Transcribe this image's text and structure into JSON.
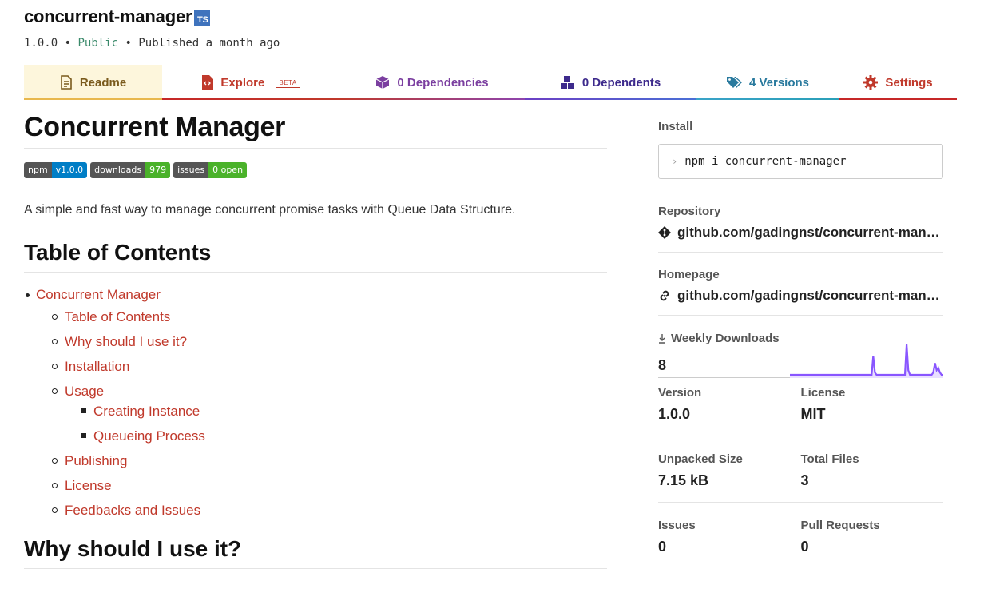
{
  "header": {
    "package_name": "concurrent-manager",
    "ts_badge": "TS",
    "version": "1.0.0",
    "separator": "•",
    "visibility": "Public",
    "published": "Published a month ago"
  },
  "tabs": [
    {
      "label": "Readme"
    },
    {
      "label": "Explore",
      "badge": "BETA"
    },
    {
      "label": "0 Dependencies"
    },
    {
      "label": "0 Dependents"
    },
    {
      "label": "4 Versions"
    },
    {
      "label": "Settings"
    }
  ],
  "readme": {
    "title": "Concurrent Manager",
    "badges": [
      {
        "left": "npm",
        "right": "v1.0.0"
      },
      {
        "left": "downloads",
        "right": "979"
      },
      {
        "left": "issues",
        "right": "0 open"
      }
    ],
    "description": "A simple and fast way to manage concurrent promise tasks with Queue Data Structure.",
    "toc_heading": "Table of Contents",
    "toc": {
      "top": "Concurrent Manager",
      "items": [
        "Table of Contents",
        "Why should I use it?",
        "Installation",
        "Usage"
      ],
      "usage_children": [
        "Creating Instance",
        "Queueing Process"
      ],
      "after_usage": [
        "Publishing",
        "License",
        "Feedbacks and Issues"
      ]
    },
    "why_heading": "Why should I use it?"
  },
  "sidebar": {
    "install_label": "Install",
    "install_prompt": "›",
    "install_command": "npm i concurrent-manager",
    "repository_label": "Repository",
    "repository_value": "github.com/gadingnst/concurrent-man…",
    "homepage_label": "Homepage",
    "homepage_value": "github.com/gadingnst/concurrent-man…",
    "weekly_label": "Weekly Downloads",
    "weekly_value": "8",
    "sparkline": {
      "color": "#8956ff",
      "fill": "#e9e0ff",
      "values": [
        1,
        1,
        1,
        1,
        1,
        1,
        1,
        1,
        1,
        1,
        1,
        1,
        1,
        1,
        1,
        1,
        1,
        1,
        1,
        1,
        1,
        1,
        1,
        1,
        1,
        1,
        1,
        1,
        1,
        1,
        1,
        1,
        1,
        1,
        1,
        1,
        1,
        1,
        1,
        1,
        1,
        1,
        1,
        1,
        1,
        1,
        1,
        1,
        1,
        1,
        9,
        2,
        1,
        1,
        1,
        1,
        1,
        1,
        1,
        1,
        1,
        1,
        1,
        1,
        1,
        1,
        1,
        1,
        1,
        1,
        14,
        3,
        1,
        1,
        1,
        1,
        1,
        1,
        1,
        1,
        1,
        1,
        1,
        1,
        1,
        1,
        2,
        6,
        3,
        4,
        2,
        1,
        1
      ]
    },
    "version_label": "Version",
    "version_value": "1.0.0",
    "license_label": "License",
    "license_value": "MIT",
    "unpacked_label": "Unpacked Size",
    "unpacked_value": "7.15 kB",
    "files_label": "Total Files",
    "files_value": "3",
    "issues_label": "Issues",
    "issues_value": "0",
    "pr_label": "Pull Requests",
    "pr_value": "0"
  }
}
